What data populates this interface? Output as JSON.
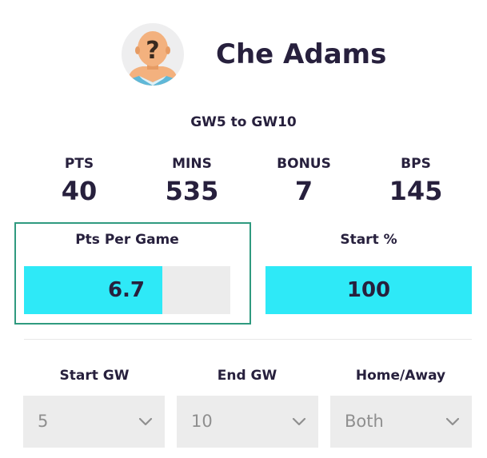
{
  "player": {
    "name": "Che Adams",
    "avatar_icon": "unknown-player-question-mark-icon"
  },
  "range_label": "GW5 to GW10",
  "stats": [
    {
      "label": "PTS",
      "value": "40"
    },
    {
      "label": "MINS",
      "value": "535"
    },
    {
      "label": "BONUS",
      "value": "7"
    },
    {
      "label": "BPS",
      "value": "145"
    }
  ],
  "pts_per_game": {
    "label": "Pts Per Game",
    "value": "6.7",
    "fill_fraction": 0.67
  },
  "start_pct": {
    "label": "Start %",
    "value": "100",
    "fill_fraction": 1.0
  },
  "filters": {
    "start_gw": {
      "label": "Start GW",
      "value": "5"
    },
    "end_gw": {
      "label": "End GW",
      "value": "10"
    },
    "home_away": {
      "label": "Home/Away",
      "value": "Both"
    }
  },
  "colors": {
    "bar_fill": "#2ee9f7",
    "bar_track": "#ececec",
    "highlight_border": "#2f9a7f",
    "text_dark": "#27203d"
  }
}
